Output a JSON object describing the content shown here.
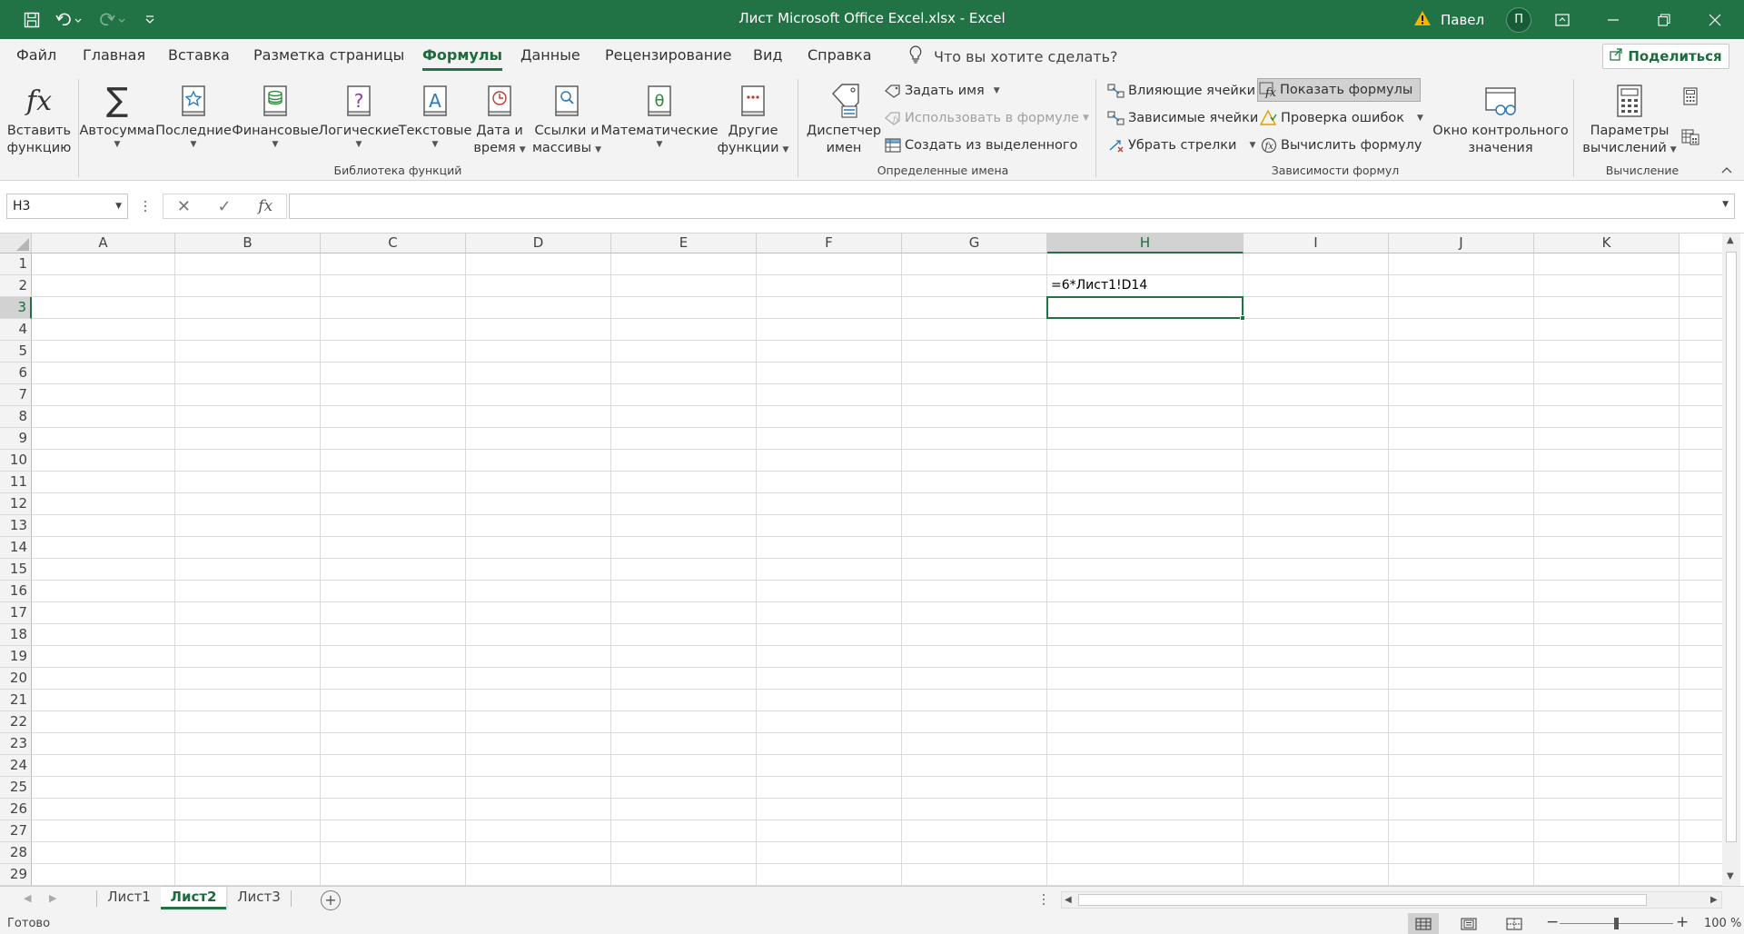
{
  "app": {
    "title": "Лист Microsoft Office Excel.xlsx  -  Excel",
    "user_name": "Павел",
    "user_initial": "П",
    "accent_color": "#217346"
  },
  "menu": {
    "tabs": [
      {
        "label": "Файл"
      },
      {
        "label": "Главная"
      },
      {
        "label": "Вставка"
      },
      {
        "label": "Разметка страницы"
      },
      {
        "label": "Формулы",
        "active": true
      },
      {
        "label": "Данные"
      },
      {
        "label": "Рецензирование"
      },
      {
        "label": "Вид"
      },
      {
        "label": "Справка"
      }
    ],
    "tell_me": "Что вы хотите сделать?",
    "share": "Поделиться"
  },
  "ribbon": {
    "library": {
      "insert_function": "Вставить\nфункцию",
      "autosum": "Автосумма",
      "recent": "Последние",
      "financial": "Финансовые",
      "logical": "Логические",
      "text": "Текстовые",
      "datetime": "Дата и\nвремя",
      "lookup": "Ссылки и\nмассивы",
      "math": "Математические",
      "more": "Другие\nфункции",
      "group_label": "Библиотека функций"
    },
    "names": {
      "manager": "Диспетчер\nимен",
      "define_name": "Задать имя",
      "use_in_formula": "Использовать в формуле",
      "create_from_selection": "Создать из выделенного",
      "group_label": "Определенные имена"
    },
    "auditing": {
      "trace_precedents": "Влияющие ячейки",
      "trace_dependents": "Зависимые ячейки",
      "remove_arrows": "Убрать стрелки",
      "show_formulas": "Показать формулы",
      "error_checking": "Проверка ошибок",
      "evaluate_formula": "Вычислить формулу",
      "watch_window": "Окно контрольного\nзначения",
      "group_label": "Зависимости формул"
    },
    "calculation": {
      "options": "Параметры\nвычислений",
      "group_label": "Вычисление"
    }
  },
  "formula_bar": {
    "name_box": "H3",
    "formula": ""
  },
  "sheet": {
    "columns": [
      "A",
      "B",
      "C",
      "D",
      "E",
      "F",
      "G",
      "H",
      "I",
      "J",
      "K"
    ],
    "selected_column": "H",
    "rows": [
      "1",
      "2",
      "3",
      "4",
      "5",
      "6",
      "7",
      "8",
      "9",
      "10",
      "11",
      "12",
      "13",
      "14",
      "15",
      "16",
      "17",
      "18",
      "19",
      "20",
      "21",
      "22",
      "23",
      "24",
      "25",
      "26",
      "27",
      "28",
      "29"
    ],
    "selected_row": "3",
    "cells": {
      "H2": "=6*Лист1!D14"
    },
    "active_cell": "H3"
  },
  "sheet_tabs": [
    {
      "label": "Лист1"
    },
    {
      "label": "Лист2",
      "active": true
    },
    {
      "label": "Лист3"
    }
  ],
  "status": {
    "ready": "Готово",
    "zoom": "100 %"
  }
}
